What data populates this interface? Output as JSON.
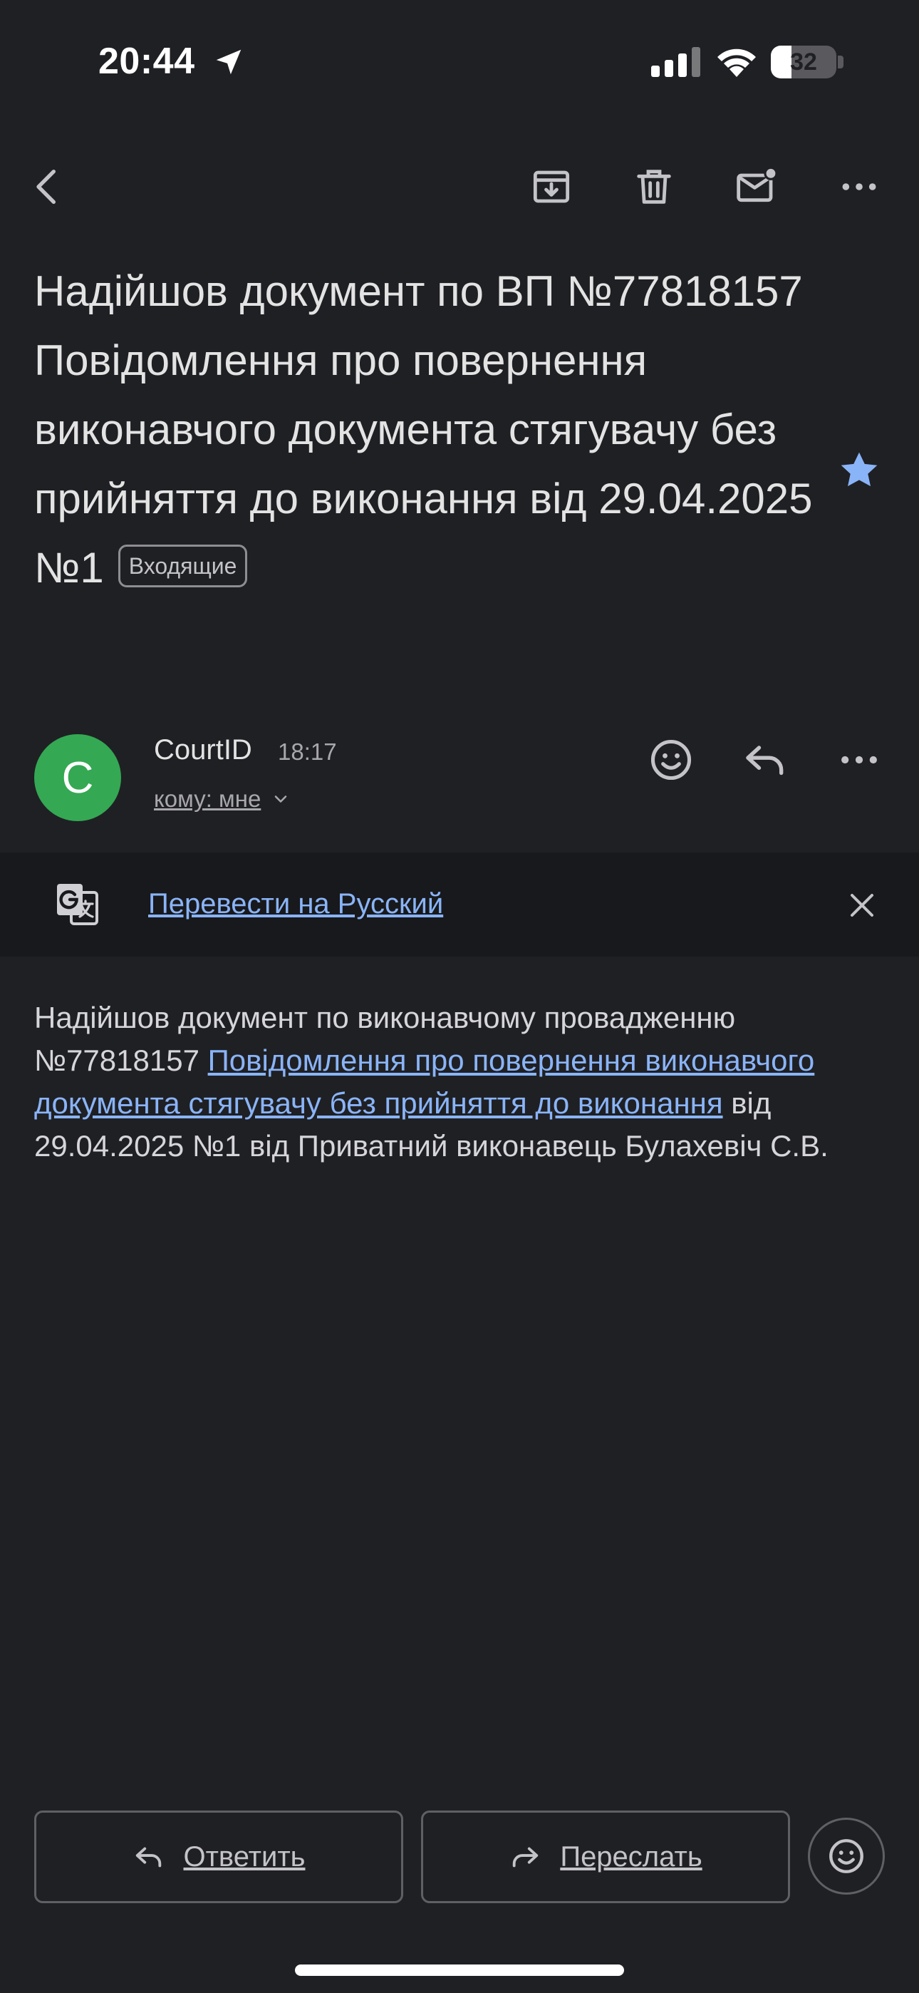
{
  "status_bar": {
    "time": "20:44",
    "battery_level": "32",
    "battery_fraction": 0.32,
    "icons": [
      "location-arrow-icon",
      "cellular-signal-icon",
      "wifi-icon",
      "battery-icon"
    ]
  },
  "toolbar": {
    "icons": [
      "back-icon",
      "archive-icon",
      "delete-icon",
      "mark-unread-icon",
      "more-options-icon"
    ]
  },
  "email": {
    "subject": "Надійшов документ по ВП №77818157 Повідомлення про повернення виконавчого документа стягувачу без прийняття до виконання від 29.04.2025 №1",
    "label": "Входящие",
    "starred": true,
    "star_color": "#8ab4f8"
  },
  "sender": {
    "avatar_letter": "C",
    "avatar_color": "#34a853",
    "name": "CourtID",
    "time": "18:17",
    "recipient": "кому: мне"
  },
  "translate_bar": {
    "link_text": "Перевести на Русский"
  },
  "body": {
    "text_before": "Надійшов документ по виконавчому провадженню №77818157 ",
    "link_text": "Повідомлення про повернення виконавчого документа стягувачу без прийняття до виконання",
    "text_after": " від 29.04.2025 №1 від Приватний виконавець Булахевіч С.В."
  },
  "actions": {
    "reply_label": "Ответить",
    "forward_label": "Переслать"
  },
  "colors": {
    "background": "#1f2024",
    "link": "#8ab4f8",
    "text": "#e3e3e3"
  }
}
